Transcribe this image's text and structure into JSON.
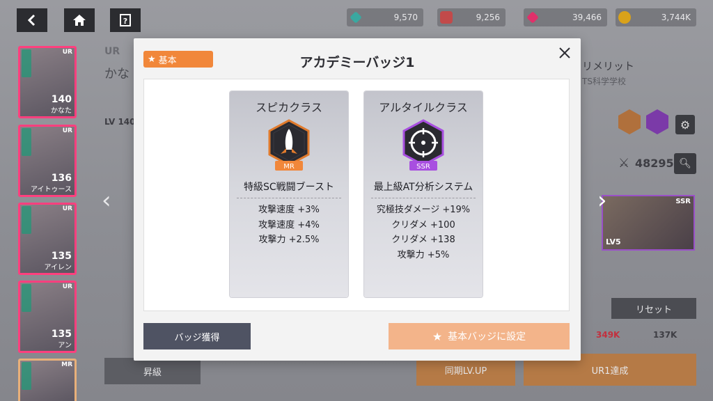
{
  "topbar": {
    "back_icon": "back-arrow-icon",
    "home_icon": "home-icon",
    "help_icon": "help-icon",
    "resources": [
      {
        "value": "9,570",
        "icon": "crystal-icon",
        "color": "#3aa8a0"
      },
      {
        "value": "9,256",
        "icon": "ticket-icon",
        "color": "#c24a4a"
      },
      {
        "value": "39,466",
        "icon": "gem-icon",
        "color": "#e0306a"
      },
      {
        "value": "3,744K",
        "icon": "coin-icon",
        "color": "#d9a21a"
      }
    ]
  },
  "character_list": [
    {
      "rarity": "UR",
      "level": "140",
      "name": "かなた"
    },
    {
      "rarity": "UR",
      "level": "136",
      "name": "アイトゥース"
    },
    {
      "rarity": "UR",
      "level": "135",
      "name": "アイレン"
    },
    {
      "rarity": "UR",
      "level": "135",
      "name": "アン"
    },
    {
      "rarity": "MR",
      "level": "",
      "name": ""
    }
  ],
  "background": {
    "rarity": "UR",
    "char_name": "かな",
    "lv_label": "LV 140",
    "right_name": "リメリット",
    "right_school": "TS科学学校",
    "power": "48295",
    "equip_rarity": "SSR",
    "equip_level": "LV5",
    "reset_label": "リセット",
    "cost_red": "349K",
    "cost_coin": "137K",
    "sync_label": "同期LV.UP",
    "ur_label": "UR1達成",
    "ascend_label": "昇級"
  },
  "modal": {
    "tag_label": "基本",
    "title": "アカデミーバッジ1",
    "badges": [
      {
        "class_name": "スピカクラス",
        "rank": "MR",
        "rank_color": "#f1873a",
        "skill_name": "特級SC戦闘ブースト",
        "stats": [
          "攻撃速度 +3%",
          "攻撃速度 +4%",
          "攻撃力 +2.5%"
        ]
      },
      {
        "class_name": "アルタイルクラス",
        "rank": "SSR",
        "rank_color": "#a84fe0",
        "skill_name": "最上級AT分析システム",
        "stats": [
          "究極技ダメージ +19%",
          "クリダメ +100",
          "クリダメ +138",
          "攻撃力 +5%"
        ]
      }
    ],
    "get_badge_label": "バッジ獲得",
    "set_basic_label": "基本バッジに設定"
  },
  "colors": {
    "accent_orange": "#f1873a",
    "button_dark": "#4f5363",
    "button_light_orange": "#f3b48a"
  }
}
